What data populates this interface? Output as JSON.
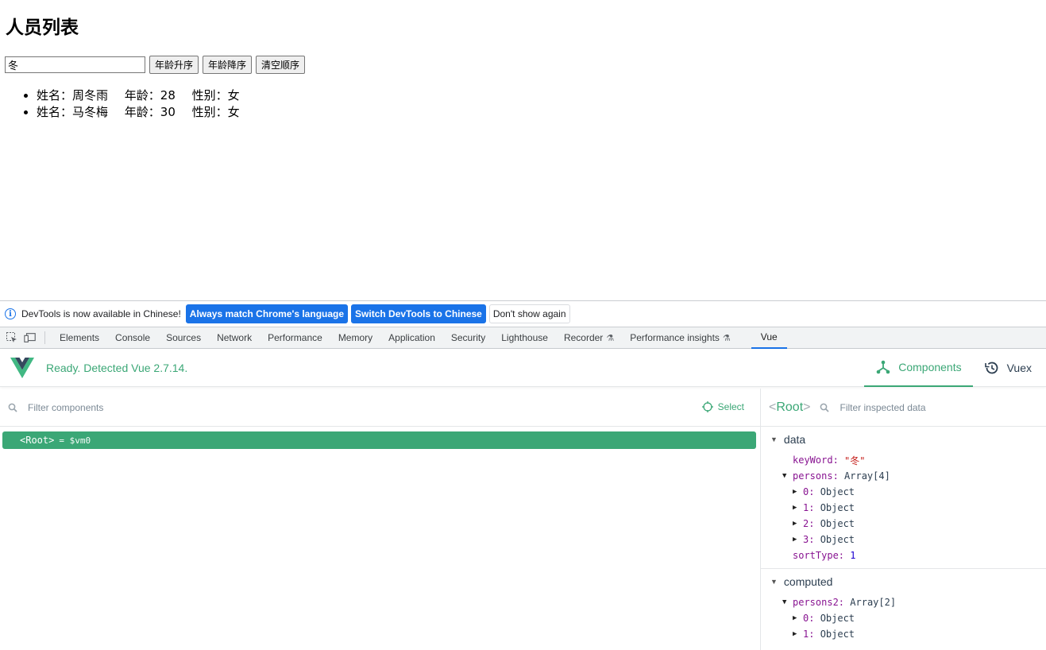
{
  "page": {
    "title": "人员列表",
    "search_value": "冬",
    "buttons": [
      "年龄升序",
      "年龄降序",
      "清空顺序"
    ],
    "persons": [
      {
        "name": "姓名：周冬雨",
        "age": "年龄：28",
        "sex": "性别：女"
      },
      {
        "name": "姓名：马冬梅",
        "age": "年龄：30",
        "sex": "性别：女"
      }
    ]
  },
  "infobar": {
    "message": "DevTools is now available in Chinese!",
    "btn_match": "Always match Chrome's language",
    "btn_switch": "Switch DevTools to Chinese",
    "btn_dismiss": "Don't show again"
  },
  "tabs": [
    "Elements",
    "Console",
    "Sources",
    "Network",
    "Performance",
    "Memory",
    "Application",
    "Security",
    "Lighthouse",
    "Recorder",
    "Performance insights",
    "Vue"
  ],
  "vue": {
    "status": "Ready. Detected Vue 2.7.14.",
    "nav_components": "Components",
    "nav_vuex": "Vuex",
    "filter_components_placeholder": "Filter components",
    "select_label": "Select",
    "root_tag": "<Root>",
    "root_eq": "= $vm0",
    "inspector_root": "Root",
    "filter_inspected_placeholder": "Filter inspected data",
    "data_section": {
      "title": "data",
      "keyword_key": "keyWord:",
      "keyword_val": "\"冬\"",
      "persons_key": "persons:",
      "persons_val": "Array[4]",
      "items": [
        {
          "key": "0:",
          "val": "Object"
        },
        {
          "key": "1:",
          "val": "Object"
        },
        {
          "key": "2:",
          "val": "Object"
        },
        {
          "key": "3:",
          "val": "Object"
        }
      ],
      "sorttype_key": "sortType:",
      "sorttype_val": "1"
    },
    "computed_section": {
      "title": "computed",
      "persons2_key": "persons2:",
      "persons2_val": "Array[2]",
      "items": [
        {
          "key": "0:",
          "val": "Object"
        },
        {
          "key": "1:",
          "val": "Object"
        }
      ]
    }
  },
  "colors": {
    "vue_green": "#3ba776",
    "chrome_blue": "#1a73e8"
  }
}
